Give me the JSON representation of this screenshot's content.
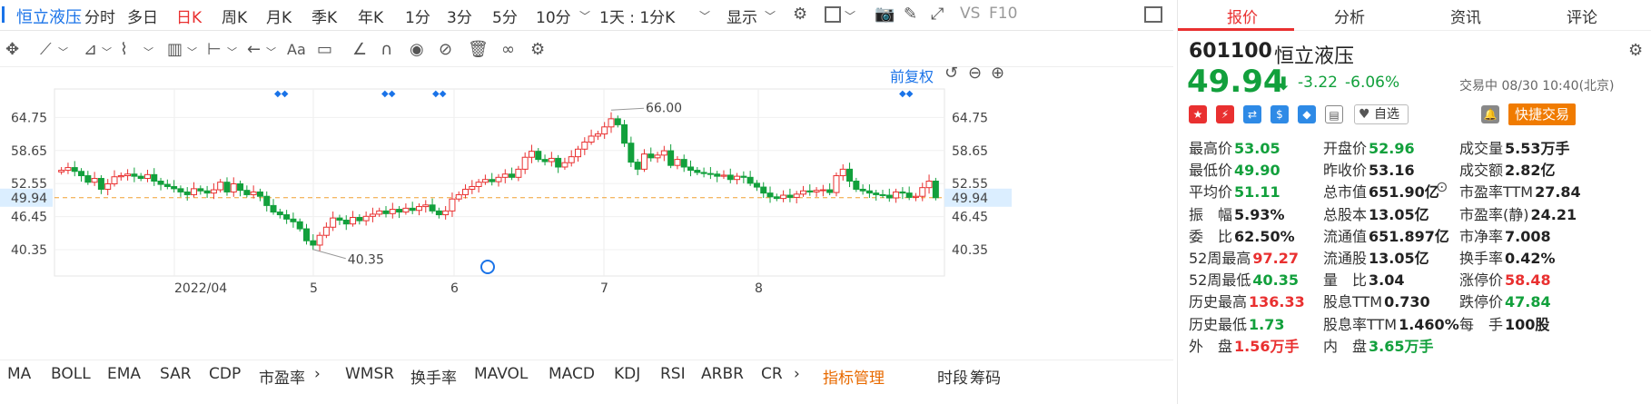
{
  "toolbar": {
    "stock_name": "恒立液压",
    "periods": [
      "分时",
      "多日",
      "日K",
      "周K",
      "月K",
      "季K",
      "年K",
      "1分",
      "3分",
      "5分",
      "10分"
    ],
    "active_period": "日K",
    "interval_select": "1天 : 1分K",
    "display_label": "显示",
    "vs_label": "VS",
    "f10_label": "F10"
  },
  "chart_top": {
    "adjust_label": "前复权"
  },
  "chart_data": {
    "type": "candlestick",
    "x_tick_labels": [
      "2022/04",
      "5",
      "6",
      "7",
      "8"
    ],
    "y_tick_labels": [
      "64.75",
      "58.65",
      "52.55",
      "49.94",
      "46.45",
      "40.35"
    ],
    "y_ticks": [
      64.75,
      58.65,
      52.55,
      46.45,
      40.35
    ],
    "ylim": [
      35.5,
      70.0
    ],
    "current_price": 49.94,
    "max_label": "66.00",
    "min_label": "40.35",
    "close_series": [
      55.0,
      55.5,
      54.8,
      54.0,
      52.8,
      53.5,
      51.5,
      52.5,
      53.8,
      54.0,
      54.3,
      53.9,
      53.5,
      54.2,
      53.0,
      52.4,
      52.0,
      51.6,
      51.0,
      50.5,
      51.6,
      51.2,
      50.8,
      51.4,
      52.8,
      51.0,
      52.5,
      51.3,
      50.5,
      51.0,
      50.2,
      48.5,
      47.3,
      46.8,
      46.0,
      45.5,
      44.2,
      42.0,
      41.2,
      43.0,
      44.5,
      46.2,
      45.8,
      45.1,
      46.3,
      45.7,
      46.5,
      46.9,
      47.5,
      47.0,
      47.8,
      47.3,
      48.0,
      47.6,
      48.3,
      48.6,
      47.5,
      46.8,
      47.5,
      49.7,
      50.5,
      51.5,
      52.0,
      52.8,
      53.3,
      52.9,
      53.7,
      54.3,
      53.7,
      55.2,
      57.4,
      58.5,
      57.0,
      56.6,
      57.2,
      55.6,
      56.4,
      57.5,
      58.9,
      60.2,
      61.3,
      61.7,
      63.0,
      64.5,
      63.4,
      60.0,
      56.5,
      55.2,
      58.0,
      57.3,
      57.8,
      58.6,
      55.9,
      57.0,
      55.6,
      55.0,
      54.6,
      54.4,
      54.3,
      53.9,
      54.1,
      53.3,
      53.9,
      53.7,
      52.6,
      51.9,
      50.8,
      50.1,
      49.8,
      50.4,
      50.0,
      50.6,
      51.2,
      51.0,
      51.3,
      51.4,
      50.9,
      54.0,
      55.2,
      53.0,
      51.5,
      51.2,
      50.8,
      50.5,
      50.4,
      49.9,
      51.0,
      50.8,
      50.0,
      50.2,
      51.8,
      53.0,
      49.94
    ]
  },
  "indicators": {
    "items": [
      "MA",
      "BOLL",
      "EMA",
      "SAR",
      "CDP",
      "市盈率",
      "WMSR",
      "换手率",
      "MAVOL",
      "MACD",
      "KDJ",
      "RSI",
      "ARBR",
      "CR"
    ],
    "manage": "指标管理",
    "right": [
      "时段",
      "筹码"
    ]
  },
  "panel": {
    "tabs": [
      "报价",
      "分析",
      "资讯",
      "评论"
    ],
    "active_tab": "报价",
    "code": "601100",
    "name": "恒立液压",
    "price": "49.94",
    "arrow": "⬇",
    "change": "-3.22",
    "change_pct": "-6.06%",
    "status": "交易中 08/30 10:40(北京)",
    "watch_label": "自选",
    "quick_trade": "快捷交易",
    "colors": {
      "up": "#e93030",
      "down": "#12a03c",
      "accent": "#1a73e8",
      "trade": "#f07b00"
    },
    "stats": [
      [
        {
          "k": "最高价",
          "v": "53.05",
          "c": "dn"
        },
        {
          "k": "开盘价",
          "v": "52.96",
          "c": "dn"
        },
        {
          "k": "成交量",
          "v": "5.53万手",
          "c": "blk"
        }
      ],
      [
        {
          "k": "最低价",
          "v": "49.90",
          "c": "dn"
        },
        {
          "k": "昨收价",
          "v": "53.16",
          "c": "blk"
        },
        {
          "k": "成交额",
          "v": "2.82亿",
          "c": "blk"
        }
      ],
      [
        {
          "k": "平均价",
          "v": "51.11",
          "c": "dn"
        },
        {
          "k": "总市值",
          "v": "651.90亿",
          "c": "blk"
        },
        {
          "k": "市盈率TTM",
          "v": "27.84",
          "c": "blk"
        }
      ],
      [
        {
          "k": "振　幅",
          "v": "5.93%",
          "c": "blk"
        },
        {
          "k": "总股本",
          "v": "13.05亿",
          "c": "blk"
        },
        {
          "k": "市盈率(静)",
          "v": "24.21",
          "c": "blk"
        }
      ],
      [
        {
          "k": "委　比",
          "v": "62.50%",
          "c": "blk"
        },
        {
          "k": "流通值",
          "v": "651.897亿",
          "c": "blk"
        },
        {
          "k": "市净率",
          "v": "7.008",
          "c": "blk"
        }
      ],
      [
        {
          "k": "52周最高",
          "v": "97.27",
          "c": "up"
        },
        {
          "k": "流通股",
          "v": "13.05亿",
          "c": "blk"
        },
        {
          "k": "换手率",
          "v": "0.42%",
          "c": "blk"
        }
      ],
      [
        {
          "k": "52周最低",
          "v": "40.35",
          "c": "dn"
        },
        {
          "k": "量　比",
          "v": "3.04",
          "c": "blk"
        },
        {
          "k": "涨停价",
          "v": "58.48",
          "c": "up"
        }
      ],
      [
        {
          "k": "历史最高",
          "v": "136.33",
          "c": "up"
        },
        {
          "k": "股息TTM",
          "v": "0.730",
          "c": "blk"
        },
        {
          "k": "跌停价",
          "v": "47.84",
          "c": "dn"
        }
      ],
      [
        {
          "k": "历史最低",
          "v": "1.73",
          "c": "dn"
        },
        {
          "k": "股息率TTM",
          "v": "1.460%",
          "c": "blk"
        },
        {
          "k": "每　手",
          "v": "100股",
          "c": "blk"
        }
      ],
      [
        {
          "k": "外　盘",
          "v": "1.56万手",
          "c": "up"
        },
        {
          "k": "内　盘",
          "v": "3.65万手",
          "c": "dn"
        },
        {
          "k": "",
          "v": "",
          "c": "blk"
        }
      ]
    ]
  }
}
